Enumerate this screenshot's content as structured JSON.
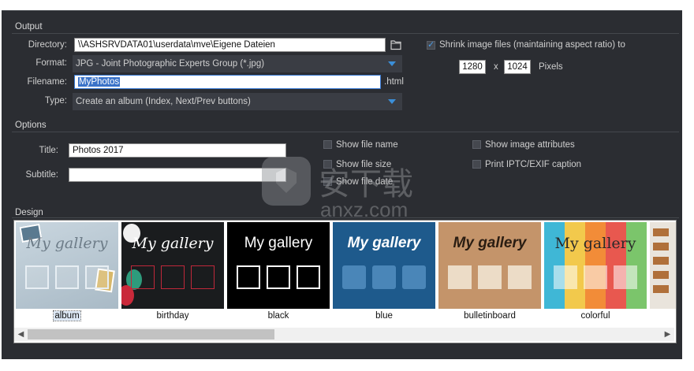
{
  "output": {
    "title": "Output",
    "directory_label": "Directory:",
    "directory_value": "\\\\ASHSRVDATA01\\userdata\\mve\\Eigene Dateien",
    "format_label": "Format:",
    "format_value": "JPG - Joint Photographic Experts Group (*.jpg)",
    "filename_label": "Filename:",
    "filename_value": "MyPhotos",
    "filename_ext": ".html",
    "type_label": "Type:",
    "type_value": "Create an album (Index, Next/Prev buttons)",
    "shrink_label": "Shrink image files (maintaining aspect ratio) to",
    "shrink_checked": true,
    "width": "1280",
    "x_sep": "x",
    "height": "1024",
    "pixels_label": "Pixels"
  },
  "options": {
    "title": "Options",
    "title_label": "Title:",
    "title_value": "Photos 2017",
    "subtitle_label": "Subtitle:",
    "subtitle_value": "",
    "show_file_name": "Show file name",
    "show_file_size": "Show file size",
    "show_file_date": "Show file date",
    "show_image_attributes": "Show image attributes",
    "print_iptc": "Print IPTC/EXIF caption"
  },
  "design": {
    "title": "Design",
    "gallery_text": "My gallery",
    "selected": "album",
    "themes": [
      {
        "name": "album"
      },
      {
        "name": "birthday"
      },
      {
        "name": "black"
      },
      {
        "name": "blue"
      },
      {
        "name": "bulletinboard"
      },
      {
        "name": "colorful"
      }
    ]
  },
  "watermark": {
    "chinese": "安下载",
    "domain": "anxz.com"
  }
}
